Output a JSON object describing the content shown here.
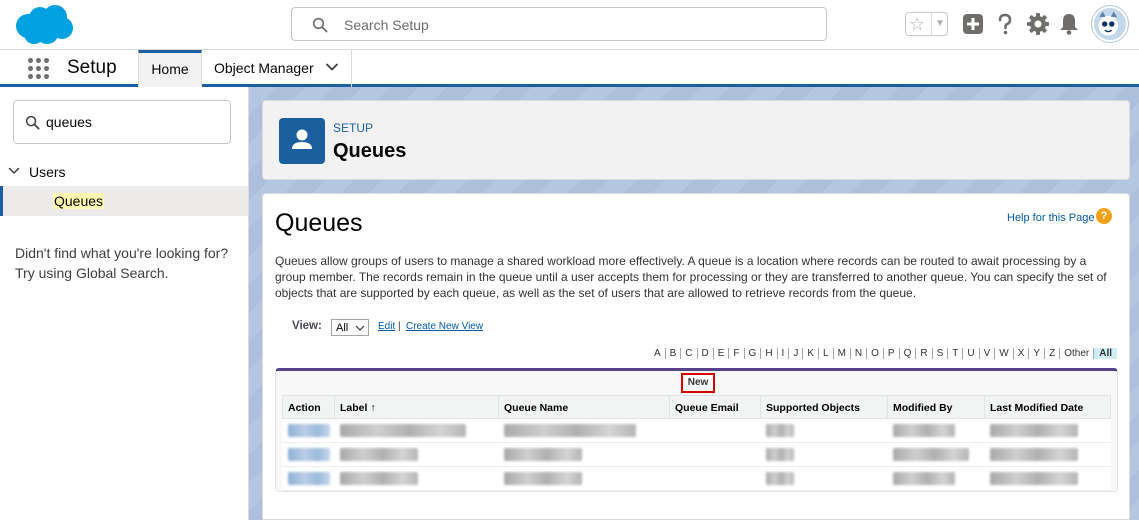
{
  "header": {
    "search_placeholder": "Search Setup"
  },
  "nav": {
    "app_name": "Setup",
    "tabs": [
      {
        "label": "Home"
      },
      {
        "label": "Object Manager"
      }
    ]
  },
  "sidebar": {
    "quick_find_value": "queues",
    "tree_section": "Users",
    "tree_item": "Queues",
    "no_find_text": "Didn't find what you're looking for? Try using Global Search."
  },
  "page_header": {
    "eyebrow": "SETUP",
    "title": "Queues"
  },
  "content": {
    "heading": "Queues",
    "help_link": "Help for this Page",
    "help_icon": "?",
    "description": "Queues allow groups of users to manage a shared workload more effectively. A queue is a location where records can be routed to await processing by a group member. The records remain in the queue until a user accepts them for processing or they are transferred to another queue. You can specify the set of objects that are supported by each queue, as well as the set of users that are allowed to retrieve records from the queue.",
    "view_label": "View:",
    "view_value": "All",
    "edit_link": "Edit",
    "view_sep": "|",
    "create_view_link": "Create New View",
    "alphabet": [
      "A",
      "B",
      "C",
      "D",
      "E",
      "F",
      "G",
      "H",
      "I",
      "J",
      "K",
      "L",
      "M",
      "N",
      "O",
      "P",
      "Q",
      "R",
      "S",
      "T",
      "U",
      "V",
      "W",
      "X",
      "Y",
      "Z",
      "Other",
      "All"
    ],
    "new_button": "New",
    "table": {
      "columns": [
        "Action",
        "Label ↑",
        "Queue Name",
        "Queue Email",
        "Supported Objects",
        "Modified By",
        "Last Modified Date"
      ]
    }
  },
  "colors": {
    "brand_blue": "#1b5f9e",
    "link": "#015ba7",
    "highlight_border": "#d40000",
    "list_accent": "#56458c"
  }
}
